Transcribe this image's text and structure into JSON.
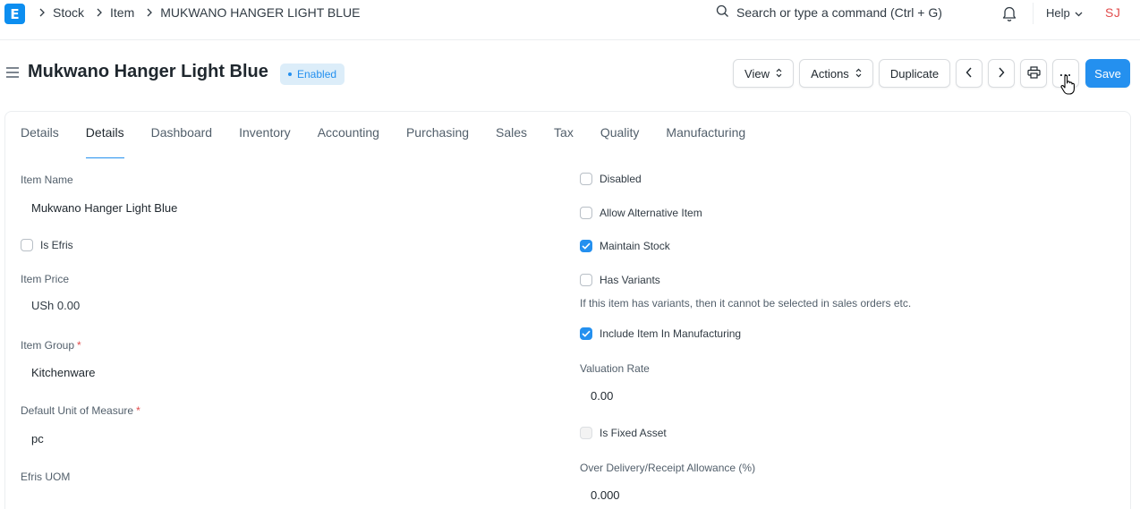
{
  "app": {
    "logo_letter": "E"
  },
  "breadcrumbs": [
    "Stock",
    "Item",
    "MUKWANO HANGER LIGHT BLUE"
  ],
  "search": {
    "placeholder": "Search or type a command (Ctrl + G)"
  },
  "navbar": {
    "help_label": "Help",
    "avatar_initials": "SJ"
  },
  "page": {
    "title": "Mukwano Hanger Light Blue",
    "status_badge": "Enabled",
    "buttons": {
      "view": "View",
      "actions": "Actions",
      "duplicate": "Duplicate",
      "more": "...",
      "save": "Save"
    }
  },
  "tabs": [
    "Details",
    "Details",
    "Dashboard",
    "Inventory",
    "Accounting",
    "Purchasing",
    "Sales",
    "Tax",
    "Quality",
    "Manufacturing"
  ],
  "active_tab_index": 1,
  "left_fields": {
    "item_name_label": "Item Name",
    "item_name_value": "Mukwano Hanger Light Blue",
    "is_efris_label": "Is Efris",
    "item_price_label": "Item Price",
    "item_price_value": "USh 0.00",
    "item_group_label": "Item Group",
    "item_group_value": "Kitchenware",
    "uom_label": "Default Unit of Measure",
    "uom_value": "pc",
    "efris_uom_label": "Efris UOM",
    "required_marker": "*"
  },
  "right_fields": {
    "disabled_label": "Disabled",
    "allow_alternative_label": "Allow Alternative Item",
    "maintain_stock_label": "Maintain Stock",
    "has_variants_label": "Has Variants",
    "has_variants_help": "If this item has variants, then it cannot be selected in sales orders etc.",
    "include_manufacturing_label": "Include Item In Manufacturing",
    "valuation_rate_label": "Valuation Rate",
    "valuation_rate_value": "0.00",
    "is_fixed_asset_label": "Is Fixed Asset",
    "over_delivery_label": "Over Delivery/Receipt Allowance (%)",
    "over_delivery_value": "0.000"
  },
  "checkbox_states": {
    "is_efris": false,
    "disabled": false,
    "allow_alternative_item": false,
    "maintain_stock": true,
    "has_variants": false,
    "include_item_in_manufacturing": true,
    "is_fixed_asset": false
  },
  "colors": {
    "accent": "#2490ef",
    "logo": "#0c8ef0",
    "required": "#e24c4c",
    "badge_bg": "#dcedf9"
  },
  "icons": [
    "chevron-right-icon",
    "search-icon",
    "bell-icon",
    "chevron-down-icon",
    "hamburger-icon",
    "updown-icon",
    "chevron-left-icon",
    "printer-icon",
    "check-icon",
    "hand-cursor-icon"
  ]
}
